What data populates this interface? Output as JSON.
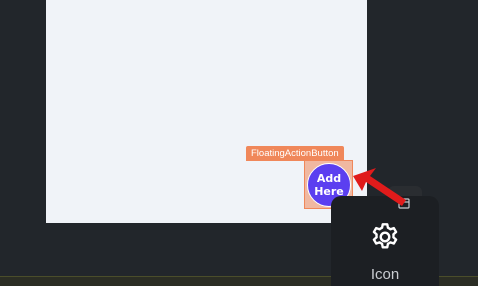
{
  "designer": {
    "selected_widget_label": "FloatingActionButton",
    "fab": {
      "text": "Add\nHere",
      "color": "#5b3ff0"
    },
    "palette_tile": {
      "label": "Icon",
      "icon": "gear-icon"
    },
    "colors": {
      "background": "#22262b",
      "canvas": "#f0f3f8",
      "selection": "#f0875a",
      "drag_arrow": "#e01b1b"
    }
  }
}
